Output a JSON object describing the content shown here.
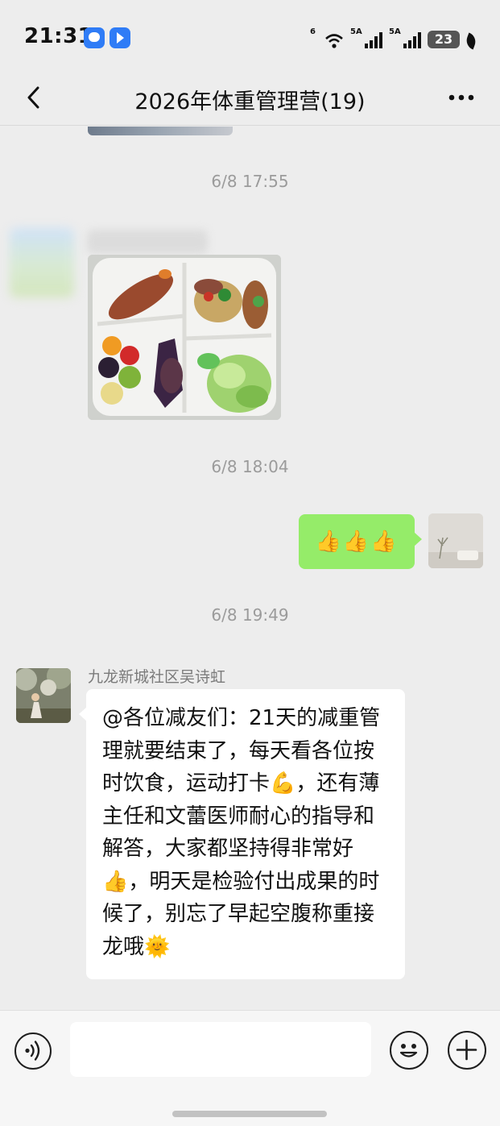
{
  "status_bar": {
    "time": "21:31",
    "wifi_label": "6",
    "sim1_label": "5A",
    "sim2_label": "5A",
    "battery": "23"
  },
  "nav": {
    "title": "2026年体重管理营(19)"
  },
  "chat": {
    "timestamps": [
      "6/8 17:55",
      "6/8 18:04",
      "6/8 19:49"
    ],
    "my_message": "👍👍👍",
    "sender_name": "九龙新城社区吴诗虹",
    "group_message": "@各位减友们：21天的减重管理就要结束了，每天看各位按时饮食，运动打卡💪，还有薄主任和文蕾医师耐心的指导和解答，大家都坚持得非常好👍，明天是检验付出成果的时候了，别忘了早起空腹称重接龙哦🌞"
  },
  "colors": {
    "background": "#ededed",
    "bubble_green": "#95ec69",
    "bubble_white": "#ffffff",
    "timestamp": "#9b9b9b"
  },
  "icons": [
    "back-icon",
    "more-icon",
    "voice-icon",
    "emoji-icon",
    "plus-icon"
  ]
}
